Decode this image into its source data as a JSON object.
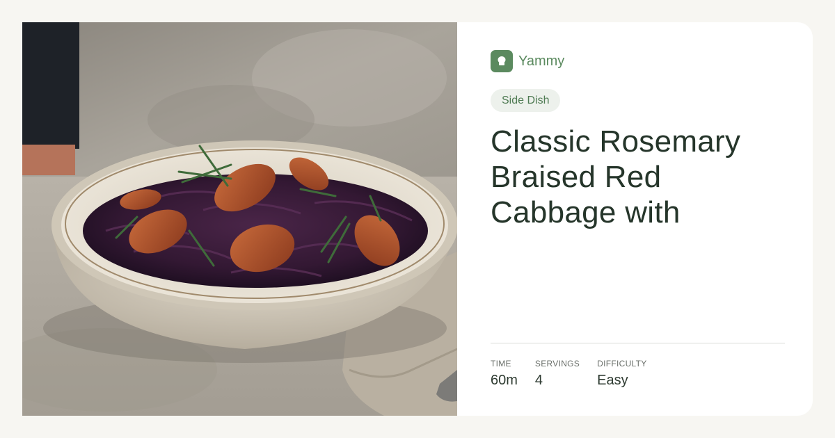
{
  "brand": {
    "name": "Yammy",
    "logo_icon": "chef-hat-icon",
    "color": "#5b8a5f"
  },
  "category_tag": "Side Dish",
  "recipe_title": "Classic Rosemary Braised Red Cabbage with",
  "photo": {
    "alt": "Bowl of braised red cabbage with sausage slices and rosemary"
  },
  "stats": [
    {
      "label": "TIME",
      "value": "60m"
    },
    {
      "label": "SERVINGS",
      "value": "4"
    },
    {
      "label": "DIFFICULTY",
      "value": "Easy"
    }
  ]
}
